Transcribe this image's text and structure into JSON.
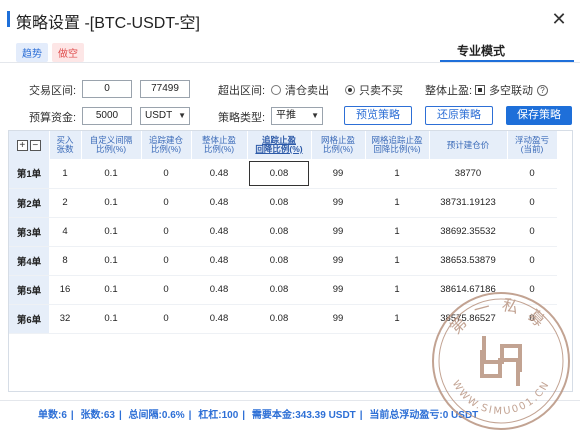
{
  "window": {
    "title": "策略设置 -[BTC-USDT-空]"
  },
  "badges": {
    "trend": "趋势",
    "short": "做空"
  },
  "tabs": {
    "pro_mode": "专业模式"
  },
  "form": {
    "trade_range_label": "交易区间:",
    "range_low": "0",
    "range_high": "77499",
    "budget_label": "预算资金:",
    "budget_value": "5000",
    "currency": "USDT",
    "out_of_range_label": "超出区间:",
    "option_close_all": "清仓卖出",
    "option_buy_only": "只卖不买",
    "overall_stop_label": "整体止盈:",
    "long_short_link": "多空联动",
    "strategy_type_label": "策略类型:",
    "strategy_type_value": "平推"
  },
  "buttons": {
    "preview": "预览策略",
    "restore": "还原策略",
    "save": "保存策略"
  },
  "table": {
    "headers": [
      "",
      "买入\n张数",
      "自定义间隔\n比例(%)",
      "追踪建仓\n比例(%)",
      "整体止盈\n比例(%)",
      "追踪止盈\n回降比例(%)",
      "网格止盈\n比例(%)",
      "网格追踪止盈\n回降比例(%)",
      "预计建仓价",
      "浮动盈亏\n(当前)"
    ],
    "rows": [
      [
        "第1单",
        "1",
        "0.1",
        "0",
        "0.48",
        "0.08",
        "99",
        "1",
        "38770",
        "0"
      ],
      [
        "第2单",
        "2",
        "0.1",
        "0",
        "0.48",
        "0.08",
        "99",
        "1",
        "38731.19123",
        "0"
      ],
      [
        "第3单",
        "4",
        "0.1",
        "0",
        "0.48",
        "0.08",
        "99",
        "1",
        "38692.35532",
        "0"
      ],
      [
        "第4单",
        "8",
        "0.1",
        "0",
        "0.48",
        "0.08",
        "99",
        "1",
        "38653.53879",
        "0"
      ],
      [
        "第5单",
        "16",
        "0.1",
        "0",
        "0.48",
        "0.08",
        "99",
        "1",
        "38614.67186",
        "0"
      ],
      [
        "第6单",
        "32",
        "0.1",
        "0",
        "0.48",
        "0.08",
        "99",
        "1",
        "38575.86527",
        "0"
      ]
    ]
  },
  "footer": {
    "orders": "单数:6",
    "contracts": "张数:63",
    "total_interval": "总间隔:0.6%",
    "leverage": "杠杠:100",
    "required_capital": "需要本金:343.39 USDT",
    "current_pnl": "当前总浮动盈亏:0 USDT"
  },
  "watermark": {
    "text_top": "第一私募",
    "text_bottom": "WWW.SIMU001.CN"
  },
  "colors": {
    "accent": "#1e6fd9",
    "header_bg": "#e6eef9",
    "watermark": "#b89380"
  }
}
